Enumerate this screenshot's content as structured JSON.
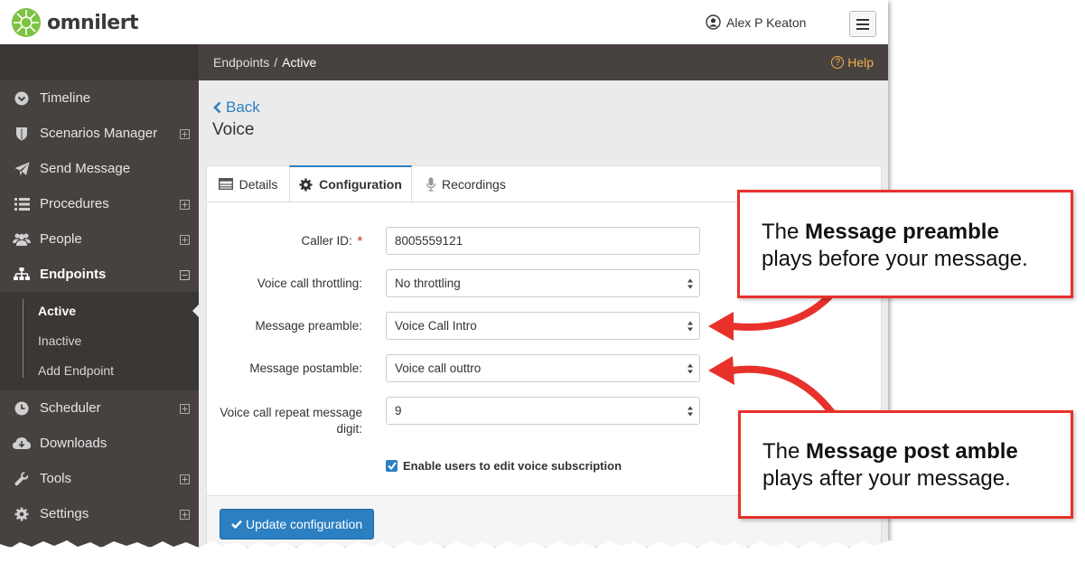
{
  "brand": {
    "name": "omnilert"
  },
  "header": {
    "user_name": "Alex P Keaton"
  },
  "breadcrumb": {
    "parent": "Endpoints",
    "separator": "/",
    "current": "Active",
    "help": "Help"
  },
  "sidebar": {
    "items": [
      {
        "label": "Timeline",
        "icon": "timeline-icon"
      },
      {
        "label": "Scenarios Manager",
        "icon": "shield-icon",
        "expand": "⊞"
      },
      {
        "label": "Send Message",
        "icon": "paper-plane-icon"
      },
      {
        "label": "Procedures",
        "icon": "list-icon",
        "expand": "⊞"
      },
      {
        "label": "People",
        "icon": "users-icon",
        "expand": "⊞"
      },
      {
        "label": "Endpoints",
        "icon": "sitemap-icon",
        "expand": "⊟"
      },
      {
        "label": "Scheduler",
        "icon": "clock-icon",
        "expand": "⊞"
      },
      {
        "label": "Downloads",
        "icon": "cloud-download-icon"
      },
      {
        "label": "Tools",
        "icon": "wrench-icon",
        "expand": "⊞"
      },
      {
        "label": "Settings",
        "icon": "gear-icon",
        "expand": "⊞"
      }
    ],
    "endpoints_sub": [
      "Active",
      "Inactive",
      "Add Endpoint"
    ]
  },
  "page": {
    "back_label": "Back",
    "title": "Voice"
  },
  "tabs": [
    {
      "label": "Details",
      "icon": "table-icon"
    },
    {
      "label": "Configuration",
      "icon": "gear-icon"
    },
    {
      "label": "Recordings",
      "icon": "microphone-icon"
    }
  ],
  "form": {
    "caller_id": {
      "label": "Caller ID:",
      "required": "*",
      "value": "8005559121"
    },
    "throttling": {
      "label": "Voice call throttling:",
      "value": "No throttling"
    },
    "preamble": {
      "label": "Message preamble:",
      "value": "Voice Call Intro"
    },
    "postamble": {
      "label": "Message postamble:",
      "value": "Voice call outtro"
    },
    "repeat_digit": {
      "label_line1": "Voice call repeat message",
      "label_line2": "digit:",
      "value": "9"
    },
    "edit_subscription": {
      "label": "Enable users to edit voice subscription",
      "checked": true
    },
    "submit_label": "Update configuration"
  },
  "callouts": {
    "preamble": {
      "pre": "The ",
      "bold": "Message preamble",
      "post": "plays before your message."
    },
    "postamble": {
      "pre": "The ",
      "bold": "Message post amble",
      "post": "plays after your message."
    }
  },
  "colors": {
    "accent": "#2c7fc0",
    "sidebar": "#474240",
    "callout_border": "#e8312b",
    "help": "#f0ad4e",
    "logo_green": "#7dc242"
  }
}
